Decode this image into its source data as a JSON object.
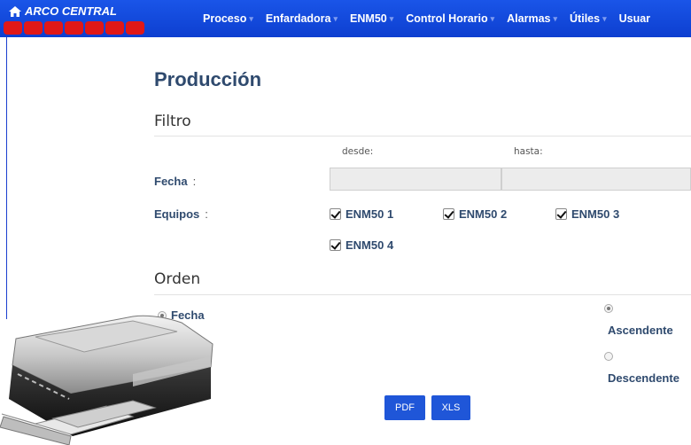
{
  "header": {
    "brand": "ARCO CENTRAL",
    "nav": [
      "Proceso",
      "Enfardadora",
      "ENM50",
      "Control Horario",
      "Alarmas",
      "Útiles",
      "Usuar"
    ]
  },
  "page": {
    "title": "Producción",
    "filter_section": "Filtro",
    "desde_label": "desde:",
    "hasta_label": "hasta:",
    "fecha_label": "Fecha",
    "equipos_label": "Equipos",
    "colon": ":",
    "equipos": [
      "ENM50 1",
      "ENM50 2",
      "ENM50 3",
      "ENM50 4"
    ],
    "desde_value": "",
    "hasta_value": "",
    "order_section": "Orden",
    "order_field": "Fecha",
    "asc_label": "Ascendente",
    "desc_label": "Descendente"
  },
  "buttons": {
    "pdf": "PDF",
    "xls": "XLS"
  },
  "colors": {
    "nav_blue": "#1a55e8",
    "brand_red": "#e01818",
    "button_blue": "#1f56d8",
    "label_navy": "#2f4a6e"
  },
  "icons": {
    "home": "home-icon",
    "printer": "printer-icon"
  }
}
